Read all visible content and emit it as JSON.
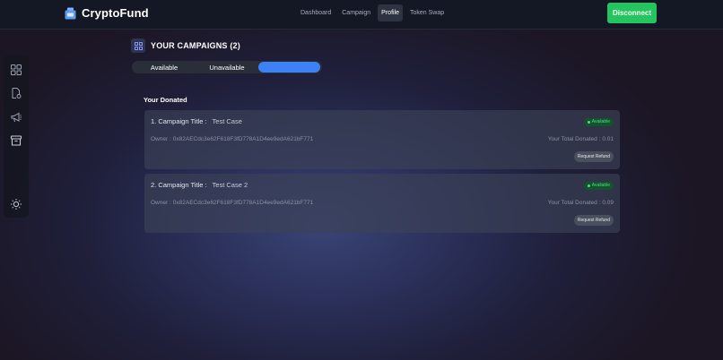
{
  "brand": {
    "name": "CryptoFund",
    "logo_icon": "fund-jar-icon"
  },
  "nav": {
    "items": [
      {
        "label": "Dashboard",
        "active": false
      },
      {
        "label": "Campaign",
        "active": false
      },
      {
        "label": "Profile",
        "active": true
      },
      {
        "label": "Token Swap",
        "active": false
      }
    ]
  },
  "disconnect_label": "Disconnect",
  "sidebar": {
    "icons": [
      "grid-icon",
      "document-settings-icon",
      "megaphone-icon",
      "archive-icon",
      "sun-icon"
    ]
  },
  "section": {
    "title": "YOUR CAMPAIGNS (2)"
  },
  "tabs": {
    "available": "Available",
    "unavailable": "Unavailable"
  },
  "donated_label": "Your Donated",
  "campaigns": [
    {
      "title_label": "1. Campaign Title :",
      "title": "Test Case",
      "status": "Available",
      "owner_label": "Owner :",
      "owner": "0x82AECdc3e62F618F3fD778A1D4ee9edA621bF771",
      "total_label": "Your Total Donated :",
      "total": "0.01",
      "refund_label": "Request Refund"
    },
    {
      "title_label": "2. Campaign Title :",
      "title": "Test Case 2",
      "status": "Available",
      "owner_label": "Owner :",
      "owner": "0x82AECdc3e62F618F3fD778A1D4ee9edA621bF771",
      "total_label": "Your Total Donated :",
      "total": "0.09",
      "refund_label": "Request Refund"
    }
  ],
  "colors": {
    "accent": "#3b82f6",
    "success": "#22c55e",
    "badge_text": "#4ade80"
  }
}
